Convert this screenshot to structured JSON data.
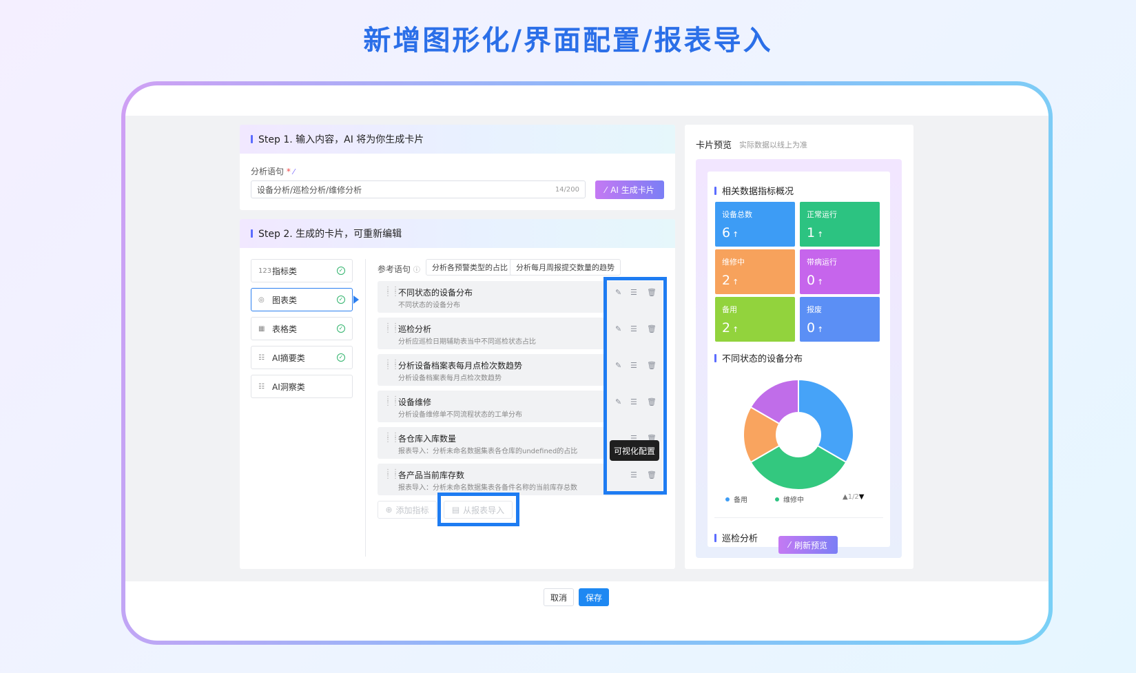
{
  "banner": {
    "title": "新增图形化/界面配置/报表导入"
  },
  "step1": {
    "title": "Step 1. 输入内容，AI 将为你生成卡片",
    "field_label": "分析语句",
    "required_mark": "*",
    "input_value": "设备分析/巡检分析/维修分析",
    "counter": "14/200",
    "generate_button": "AI 生成卡片"
  },
  "step2": {
    "title": "Step 2. 生成的卡片，可重新编辑",
    "categories": [
      {
        "label": "指标类",
        "icon": "123",
        "checked": true
      },
      {
        "label": "图表类",
        "icon": "◎",
        "checked": true,
        "selected": true
      },
      {
        "label": "表格类",
        "icon": "▦",
        "checked": true
      },
      {
        "label": "AI摘要类",
        "icon": "☷",
        "checked": true
      },
      {
        "label": "AI洞察类",
        "icon": "☷",
        "checked": false
      }
    ],
    "ref_label": "参考语句",
    "ref_chips": [
      "分析各预警类型的占比",
      "分析每月周报提交数量的趋势"
    ],
    "items": [
      {
        "title": "不同状态的设备分布",
        "desc": "不同状态的设备分布"
      },
      {
        "title": "巡检分析",
        "desc": "分析应巡检日期辅助表当中不同巡检状态占比"
      },
      {
        "title": "分析设备档案表每月点检次数趋势",
        "desc": "分析设备档案表每月点检次数趋势"
      },
      {
        "title": "设备维修",
        "desc": "分析设备维修单不同流程状态的工单分布"
      },
      {
        "title": "各仓库入库数量",
        "desc": "报表导入：分析未命名数据集表各仓库的undefined的占比"
      },
      {
        "title": "各产品当前库存数",
        "desc": "报表导入：分析未命名数据集表各备件名称的当前库存总数"
      }
    ],
    "tooltip": "可视化配置",
    "add_button": "添加指标",
    "import_button": "从报表导入"
  },
  "preview": {
    "title": "卡片预览",
    "subtitle": "实际数据以线上为准",
    "metrics_title": "相关数据指标概况",
    "tiles": [
      {
        "label": "设备总数",
        "value": "6",
        "arrow": "↑",
        "color": "#3d9cf5"
      },
      {
        "label": "正常运行",
        "value": "1",
        "arrow": "↑",
        "color": "#2cc381"
      },
      {
        "label": "维修中",
        "value": "2",
        "arrow": "↑",
        "color": "#f7a25c"
      },
      {
        "label": "带病运行",
        "value": "0",
        "arrow": "↑",
        "color": "#c665ec"
      },
      {
        "label": "备用",
        "value": "2",
        "arrow": "↑",
        "color": "#92d33d"
      },
      {
        "label": "报废",
        "value": "0",
        "arrow": "↑",
        "color": "#5b8ff5"
      }
    ],
    "chart_title": "不同状态的设备分布",
    "legend": [
      {
        "name": "备用",
        "color": "#3d9cf5"
      },
      {
        "name": "维修中",
        "color": "#2cc381"
      }
    ],
    "pager": "1/2",
    "next_title": "巡检分析",
    "refresh_button": "刷新预览"
  },
  "chart_data": {
    "type": "pie",
    "title": "不同状态的设备分布",
    "slices": [
      {
        "name": "备用",
        "value": 2,
        "color": "#46a3f8"
      },
      {
        "name": "维修中",
        "value": 2,
        "color": "#33c87f"
      },
      {
        "name": "",
        "value": 1,
        "color": "#f9a45f"
      },
      {
        "name": "",
        "value": 1,
        "color": "#c06de9"
      }
    ]
  },
  "footer": {
    "cancel": "取消",
    "save": "保存"
  }
}
